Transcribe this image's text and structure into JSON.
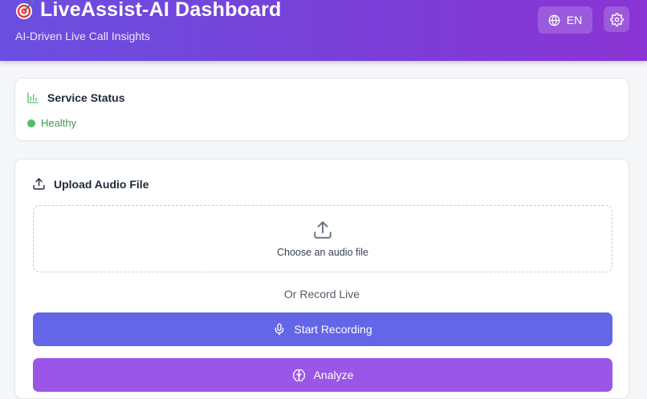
{
  "header": {
    "title": "LiveAssist-AI Dashboard",
    "subtitle": "AI-Driven Live Call Insights",
    "language_label": "EN",
    "logo_icon": "dart-target-icon",
    "language_icon": "globe-icon",
    "settings_icon": "gear-icon"
  },
  "status": {
    "title": "Service Status",
    "icon": "bar-chart-icon",
    "value": "Healthy",
    "color": "#4fbf6a"
  },
  "upload": {
    "title": "Upload Audio File",
    "icon": "upload-icon",
    "dropzone_label": "Choose an audio file",
    "or_label": "Or Record Live",
    "record_label": "Start Recording",
    "record_icon": "microphone-icon",
    "analyze_label": "Analyze",
    "analyze_icon": "brain-icon"
  },
  "colors": {
    "header_gradient_start": "#6a4fe0",
    "header_gradient_end": "#8a34d4",
    "record_button": "#6466e8",
    "analyze_button": "#9a56e6",
    "healthy": "#4fbf6a"
  }
}
